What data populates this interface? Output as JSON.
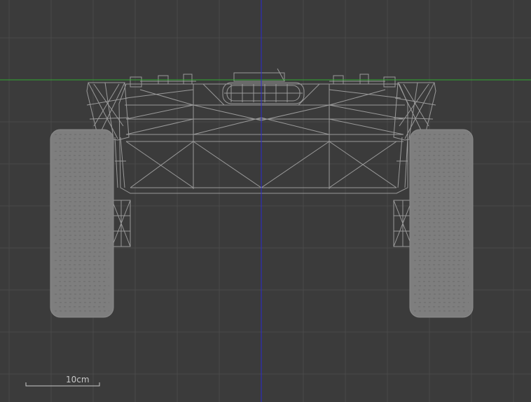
{
  "viewport": {
    "view": "front",
    "colors": {
      "background": "#3b3b3b",
      "grid": "#4a4a4a",
      "horizontal_axis": "#2fa82f",
      "vertical_axis": "#2a2ad0",
      "wireframe": "#9a9a9a",
      "wheel_fill": "#7e7e7e"
    }
  },
  "scale_bar": {
    "label": "10cm"
  }
}
